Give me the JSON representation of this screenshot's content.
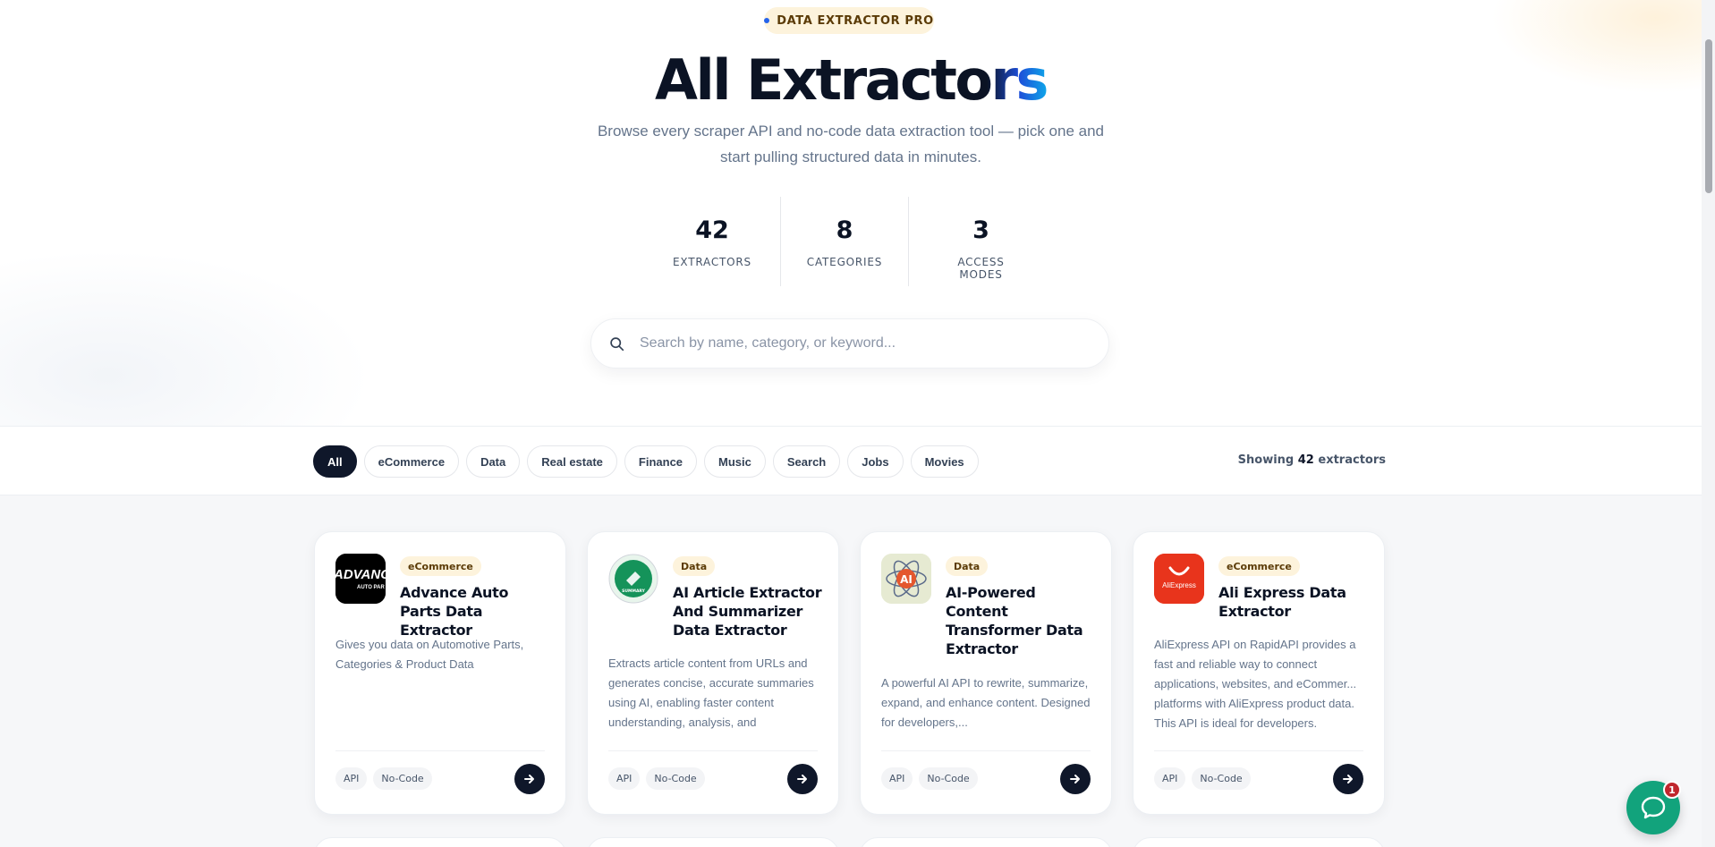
{
  "hero": {
    "badge": "DATA EXTRACTOR PRO",
    "title_part1": "All Extract",
    "title_part2": "ors",
    "subtitle": "Browse every scraper API and no-code data extraction tool — pick one and start pulling structured data in minutes.",
    "stats": [
      {
        "value": "42",
        "label": "EXTRACTORS"
      },
      {
        "value": "8",
        "label": "CATEGORIES"
      },
      {
        "value": "3",
        "label": "ACCESS MODES"
      }
    ]
  },
  "search": {
    "placeholder": "Search by name, category, or keyword..."
  },
  "filters": {
    "chips": [
      "All",
      "eCommerce",
      "Data",
      "Real estate",
      "Finance",
      "Music",
      "Search",
      "Jobs",
      "Movies"
    ],
    "active": "All",
    "showing_prefix": "Showing",
    "showing_count": "42",
    "showing_suffix": "extractors"
  },
  "cards": [
    {
      "category": "eCommerce",
      "name": "Advance Auto Parts Data Extractor",
      "description": "Gives you data on Automotive Parts, Categories & Product Data",
      "tags": [
        "API",
        "No-Code"
      ],
      "logo_text": "ADVANC",
      "logo_subtext": "AUTO PAR"
    },
    {
      "category": "Data",
      "name": "AI Article Extractor And Summarizer Data Extractor",
      "description": "Extracts article content from URLs and generates concise, accurate summaries using AI, enabling faster content understanding, analysis, and",
      "tags": [
        "API",
        "No-Code"
      ],
      "logo_text": "SUMMARY"
    },
    {
      "category": "Data",
      "name": "AI-Powered Content Transformer Data Extractor",
      "description": "A powerful AI API to rewrite, summarize, expand, and enhance content. Designed for developers,...",
      "tags": [
        "API",
        "No-Code"
      ],
      "logo_text": "AI"
    },
    {
      "category": "eCommerce",
      "name": "Ali Express Data Extractor",
      "description": "AliExpress API on RapidAPI provides a fast and reliable way to connect applications, websites, and eCommer... platforms with AliExpress product data. This API is ideal for developers.",
      "tags": [
        "API",
        "No-Code"
      ],
      "logo_text": "AliExpress"
    }
  ],
  "chat": {
    "badge_count": "1"
  },
  "colors": {
    "accent_dark": "#0f172a",
    "badge_bg": "#fdf3dc",
    "title_gradient_end": "#0ea5e9",
    "chat_green": "#12a37c",
    "notification_red": "#c0262d"
  }
}
